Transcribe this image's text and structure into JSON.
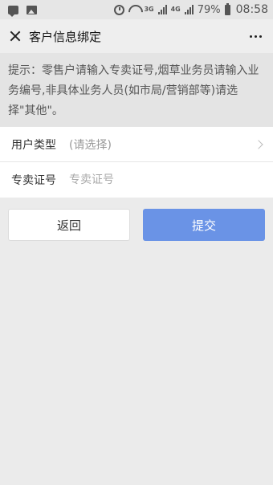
{
  "status_bar": {
    "network_3g": "3G",
    "network_4g": "4G",
    "battery": "79%",
    "time": "08:58"
  },
  "header": {
    "title": "客户信息绑定"
  },
  "notice": {
    "text": "提示：零售户请输入专卖证号,烟草业务员请输入业务编号,非具体业务人员(如市局/营销部等)请选择\"其他\"。"
  },
  "form": {
    "user_type_label": "用户类型",
    "user_type_value": "(请选择)",
    "license_label": "专卖证号",
    "license_placeholder": "专卖证号",
    "license_value": ""
  },
  "buttons": {
    "back": "返回",
    "submit": "提交"
  },
  "colors": {
    "submit_button": "#6a93e6"
  }
}
